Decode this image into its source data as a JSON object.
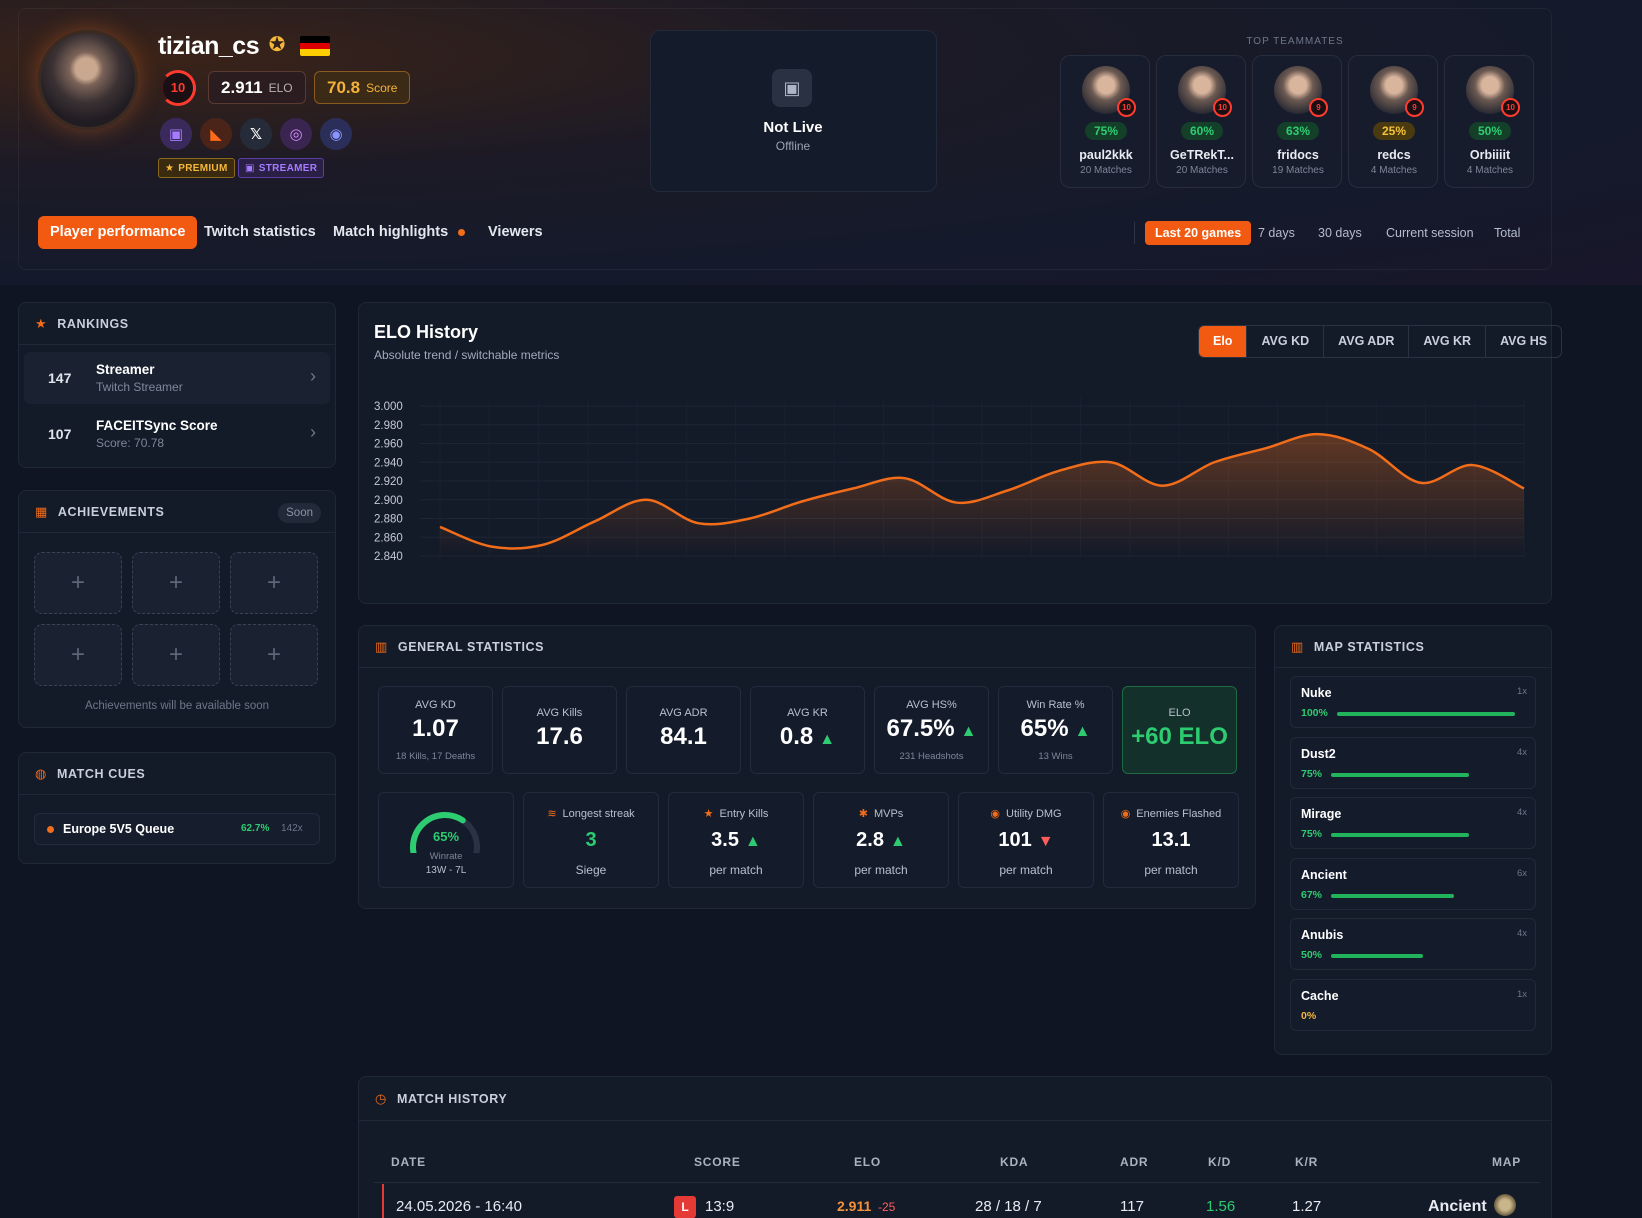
{
  "profile": {
    "username": "tizian_cs",
    "level": "10",
    "elo_value": "2.911",
    "elo_label": "ELO",
    "score_value": "70.8",
    "score_label": "Score",
    "badges": {
      "premium": "PREMIUM",
      "streamer": "STREAMER"
    },
    "socials": [
      "twitch-icon",
      "faceit-icon",
      "x-icon",
      "instagram-icon",
      "discord-icon"
    ]
  },
  "live": {
    "title": "Not Live",
    "status": "Offline"
  },
  "teammates": {
    "title": "TOP TEAMMATES",
    "items": [
      {
        "name": "paul2kkk",
        "pct": "75%",
        "matches": "20 Matches",
        "level": "10"
      },
      {
        "name": "GeTRekT...",
        "pct": "60%",
        "matches": "20 Matches",
        "level": "10"
      },
      {
        "name": "fridocs",
        "pct": "63%",
        "matches": "19 Matches",
        "level": "9"
      },
      {
        "name": "redcs",
        "pct": "25%",
        "matches": "4 Matches",
        "level": "9"
      },
      {
        "name": "Orbiiiit",
        "pct": "50%",
        "matches": "4 Matches",
        "level": "10"
      }
    ]
  },
  "nav": {
    "tabs": [
      "Player performance",
      "Twitch statistics",
      "Match highlights",
      "Viewers"
    ],
    "ranges": [
      "Last 20 games",
      "7 days",
      "30 days",
      "Current session",
      "Total"
    ]
  },
  "rankings": {
    "title": "RANKINGS",
    "items": [
      {
        "rank": "147",
        "title": "Streamer",
        "sub": "Twitch Streamer"
      },
      {
        "rank": "107",
        "title": "FACEITSync Score",
        "sub": "Score: 70.78"
      }
    ]
  },
  "achievements": {
    "title": "ACHIEVEMENTS",
    "soon": "Soon",
    "note": "Achievements will be available soon",
    "slot": "+"
  },
  "cues": {
    "title": "MATCH CUES",
    "queue": "Europe 5V5 Queue",
    "pct": "62.7%",
    "count": "142x"
  },
  "chart_data": {
    "type": "area",
    "title": "ELO History",
    "subtitle": "Absolute trend / switchable metrics",
    "tabs": [
      "Elo",
      "AVG KD",
      "AVG ADR",
      "AVG KR",
      "AVG HS"
    ],
    "yticks": [
      "3.000",
      "2.980",
      "2.960",
      "2.940",
      "2.920",
      "2.900",
      "2.880",
      "2.860",
      "2.840"
    ],
    "ylim": [
      2840,
      3000
    ],
    "series": [
      {
        "values": [
          2871,
          2850,
          2852,
          2877,
          2900,
          2875,
          2880,
          2898,
          2912,
          2923,
          2897,
          2910,
          2931,
          2940,
          2915,
          2940,
          2955,
          2970,
          2954,
          2918,
          2937,
          2912
        ]
      }
    ],
    "color": "#f26d1a",
    "grid": true
  },
  "general": {
    "title": "GENERAL STATISTICS",
    "cards": [
      {
        "label": "AVG KD",
        "value": "1.07",
        "sub": "18 Kills, 17 Deaths",
        "trend": ""
      },
      {
        "label": "AVG Kills",
        "value": "17.6",
        "sub": "",
        "trend": ""
      },
      {
        "label": "AVG ADR",
        "value": "84.1",
        "sub": "",
        "trend": ""
      },
      {
        "label": "AVG KR",
        "value": "0.8",
        "sub": "",
        "trend": "▲"
      },
      {
        "label": "AVG HS%",
        "value": "67.5%",
        "sub": "231 Headshots",
        "trend": "▲"
      },
      {
        "label": "Win Rate %",
        "value": "65%",
        "sub": "13 Wins",
        "trend": "▲"
      },
      {
        "label": "ELO",
        "value": "+60 ELO",
        "sub": "",
        "trend": ""
      }
    ],
    "winrate": {
      "pct": "65%",
      "label": "Winrate",
      "record": "13W - 7L",
      "fraction": 0.65
    },
    "extra": [
      {
        "label": "Longest streak",
        "value": "3",
        "sub": "Siege",
        "icon": "stack-icon",
        "trend": ""
      },
      {
        "label": "Entry Kills",
        "value": "3.5",
        "sub": "per match",
        "icon": "star-icon",
        "trend": "▲"
      },
      {
        "label": "MVPs",
        "value": "2.8",
        "sub": "per match",
        "icon": "gear-icon",
        "trend": "▲"
      },
      {
        "label": "Utility DMG",
        "value": "101",
        "sub": "per match",
        "icon": "utility-icon",
        "trend": "▼"
      },
      {
        "label": "Enemies Flashed",
        "value": "13.1",
        "sub": "per match",
        "icon": "eye-icon",
        "trend": ""
      }
    ]
  },
  "maps": {
    "title": "MAP STATISTICS",
    "items": [
      {
        "name": "Nuke",
        "pct": "100%",
        "count": "1x",
        "fraction": 1.0
      },
      {
        "name": "Dust2",
        "pct": "75%",
        "count": "4x",
        "fraction": 0.75
      },
      {
        "name": "Mirage",
        "pct": "75%",
        "count": "4x",
        "fraction": 0.75
      },
      {
        "name": "Ancient",
        "pct": "67%",
        "count": "6x",
        "fraction": 0.67
      },
      {
        "name": "Anubis",
        "pct": "50%",
        "count": "4x",
        "fraction": 0.5
      },
      {
        "name": "Cache",
        "pct": "0%",
        "count": "1x",
        "fraction": 0.0
      }
    ]
  },
  "history": {
    "title": "MATCH HISTORY",
    "columns": [
      "DATE",
      "SCORE",
      "ELO",
      "KDA",
      "ADR",
      "K/D",
      "K/R",
      "MAP"
    ],
    "rows": [
      {
        "date": "24.05.2026 - 16:40",
        "result": "L",
        "score": "13:9",
        "elo": "2.911",
        "elo_change": "-25",
        "kda": "28 / 18 / 7",
        "adr": "117",
        "kd": "1.56",
        "kr": "1.27",
        "map": "Ancient"
      }
    ]
  }
}
